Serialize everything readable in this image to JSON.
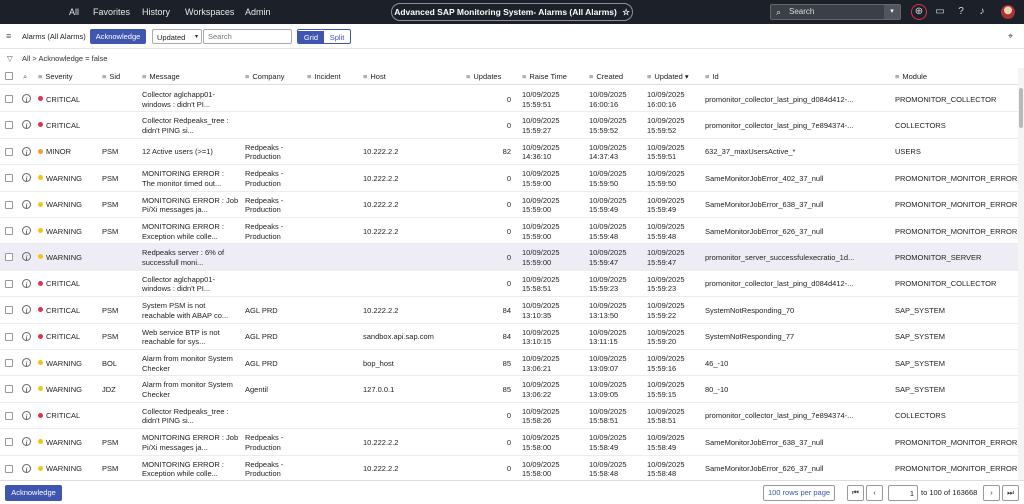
{
  "topnav": {
    "home": "All",
    "favorites": "Favorites",
    "history": "History",
    "workspaces": "Workspaces",
    "admin": "Admin",
    "title": "Advanced SAP Monitoring System- Alarms (All Alarms)",
    "search_placeholder": "Search"
  },
  "toolbar": {
    "list_title": "Alarms (All Alarms)",
    "acknowledge": "Acknowledge",
    "sort_field": "Updated",
    "search_placeholder": "Search",
    "grid": "Grid",
    "split": "Split"
  },
  "filter": {
    "breadcrumb": "All > Acknowledge = false"
  },
  "columns": [
    "Severity",
    "Sid",
    "Message",
    "Company",
    "Incident",
    "Host",
    "Updates",
    "Raise Time",
    "Created",
    "Updated",
    "Id",
    "Module"
  ],
  "rows": [
    {
      "severity": "CRITICAL",
      "color": "#e0334a",
      "sid": "",
      "msg1": "Collector aglchapp01-",
      "msg2": "windows : didn't PI...",
      "co1": "",
      "co2": "",
      "host": "",
      "updates": "0",
      "r1": "10/09/2025",
      "r2": "15:59:51",
      "c1": "10/09/2025",
      "c2": "16:00:16",
      "u1": "10/09/2025",
      "u2": "16:00:16",
      "id": "promonitor_collector_last_ping_d084d412-...",
      "module": "PROMONITOR_COLLECTOR"
    },
    {
      "severity": "CRITICAL",
      "color": "#e0334a",
      "sid": "",
      "msg1": "Collector Redpeaks_tree :",
      "msg2": "didn't PING si...",
      "co1": "",
      "co2": "",
      "host": "",
      "updates": "0",
      "r1": "10/09/2025",
      "r2": "15:59:27",
      "c1": "10/09/2025",
      "c2": "15:59:52",
      "u1": "10/09/2025",
      "u2": "15:59:52",
      "id": "promonitor_collector_last_ping_7e894374-...",
      "module": "COLLECTORS"
    },
    {
      "severity": "MINOR",
      "color": "#f29d38",
      "sid": "PSM",
      "msg1": "12 Active users (>=1)",
      "msg2": "",
      "co1": "Redpeaks -",
      "co2": "Production",
      "host": "10.222.2.2",
      "updates": "82",
      "r1": "10/09/2025",
      "r2": "14:36:10",
      "c1": "10/09/2025",
      "c2": "14:37:43",
      "u1": "10/09/2025",
      "u2": "15:59:51",
      "id": "632_37_maxUsersActive_*",
      "module": "USERS"
    },
    {
      "severity": "WARNING",
      "color": "#f2c318",
      "sid": "PSM",
      "msg1": "MONITORING ERROR :",
      "msg2": "The monitor timed out...",
      "co1": "Redpeaks -",
      "co2": "Production",
      "host": "10.222.2.2",
      "updates": "0",
      "r1": "10/09/2025",
      "r2": "15:59:00",
      "c1": "10/09/2025",
      "c2": "15:59:50",
      "u1": "10/09/2025",
      "u2": "15:59:50",
      "id": "SameMonitorJobError_402_37_null",
      "module": "PROMONITOR_MONITOR_ERROR"
    },
    {
      "severity": "WARNING",
      "color": "#f2c318",
      "sid": "PSM",
      "msg1": "MONITORING ERROR : Job",
      "msg2": "Pi/Xi messages ja...",
      "co1": "Redpeaks -",
      "co2": "Production",
      "host": "10.222.2.2",
      "updates": "0",
      "r1": "10/09/2025",
      "r2": "15:59:00",
      "c1": "10/09/2025",
      "c2": "15:59:49",
      "u1": "10/09/2025",
      "u2": "15:59:49",
      "id": "SameMonitorJobError_638_37_null",
      "module": "PROMONITOR_MONITOR_ERROR"
    },
    {
      "severity": "WARNING",
      "color": "#f2c318",
      "sid": "PSM",
      "msg1": "MONITORING ERROR :",
      "msg2": "Exception while colle...",
      "co1": "Redpeaks -",
      "co2": "Production",
      "host": "10.222.2.2",
      "updates": "0",
      "r1": "10/09/2025",
      "r2": "15:59:00",
      "c1": "10/09/2025",
      "c2": "15:59:48",
      "u1": "10/09/2025",
      "u2": "15:59:48",
      "id": "SameMonitorJobError_626_37_null",
      "module": "PROMONITOR_MONITOR_ERROR"
    },
    {
      "severity": "WARNING",
      "color": "#f2c318",
      "sid": "",
      "msg1": "Redpeaks server : 6% of",
      "msg2": "successfull moni...",
      "co1": "",
      "co2": "",
      "host": "",
      "updates": "0",
      "r1": "10/09/2025",
      "r2": "15:59:00",
      "c1": "10/09/2025",
      "c2": "15:59:47",
      "u1": "10/09/2025",
      "u2": "15:59:47",
      "id": "promonitor_server_successfulexecratio_1d...",
      "module": "PROMONITOR_SERVER",
      "selected": true
    },
    {
      "severity": "CRITICAL",
      "color": "#e0334a",
      "sid": "",
      "msg1": "Collector aglchapp01-",
      "msg2": "windows : didn't PI...",
      "co1": "",
      "co2": "",
      "host": "",
      "updates": "0",
      "r1": "10/09/2025",
      "r2": "15:58:51",
      "c1": "10/09/2025",
      "c2": "15:59:23",
      "u1": "10/09/2025",
      "u2": "15:59:23",
      "id": "promonitor_collector_last_ping_d084d412-...",
      "module": "PROMONITOR_COLLECTOR"
    },
    {
      "severity": "CRITICAL",
      "color": "#e0334a",
      "sid": "PSM",
      "msg1": "System PSM is not",
      "msg2": "reachable with ABAP co...",
      "co1": "AGL PRD",
      "co2": "",
      "host": "10.222.2.2",
      "updates": "84",
      "r1": "10/09/2025",
      "r2": "13:10:35",
      "c1": "10/09/2025",
      "c2": "13:13:50",
      "u1": "10/09/2025",
      "u2": "15:59:22",
      "id": "SystemNotResponding_70",
      "module": "SAP_SYSTEM"
    },
    {
      "severity": "CRITICAL",
      "color": "#e0334a",
      "sid": "PSM",
      "msg1": "Web service BTP is not",
      "msg2": "reachable for sys...",
      "co1": "AGL PRD",
      "co2": "",
      "host": "sandbox.api.sap.com",
      "updates": "84",
      "r1": "10/09/2025",
      "r2": "13:10:15",
      "c1": "10/09/2025",
      "c2": "13:11:15",
      "u1": "10/09/2025",
      "u2": "15:59:20",
      "id": "SystemNotResponding_77",
      "module": "SAP_SYSTEM"
    },
    {
      "severity": "WARNING",
      "color": "#f2c318",
      "sid": "BOL",
      "msg1": "Alarm from monitor System",
      "msg2": "Checker",
      "co1": "AGL PRD",
      "co2": "",
      "host": "bop_host",
      "updates": "85",
      "r1": "10/09/2025",
      "r2": "13:06:21",
      "c1": "10/09/2025",
      "c2": "13:09:07",
      "u1": "10/09/2025",
      "u2": "15:59:16",
      "id": "46_-10",
      "module": "SAP_SYSTEM"
    },
    {
      "severity": "WARNING",
      "color": "#f2c318",
      "sid": "JDZ",
      "msg1": "Alarm from monitor System",
      "msg2": "Checker",
      "co1": "Agentil",
      "co2": "",
      "host": "127.0.0.1",
      "updates": "85",
      "r1": "10/09/2025",
      "r2": "13:06:22",
      "c1": "10/09/2025",
      "c2": "13:09:05",
      "u1": "10/09/2025",
      "u2": "15:59:15",
      "id": "80_-10",
      "module": "SAP_SYSTEM"
    },
    {
      "severity": "CRITICAL",
      "color": "#e0334a",
      "sid": "",
      "msg1": "Collector Redpeaks_tree :",
      "msg2": "didn't PING si...",
      "co1": "",
      "co2": "",
      "host": "",
      "updates": "0",
      "r1": "10/09/2025",
      "r2": "15:58:26",
      "c1": "10/09/2025",
      "c2": "15:58:51",
      "u1": "10/09/2025",
      "u2": "15:58:51",
      "id": "promonitor_collector_last_ping_7e894374-...",
      "module": "COLLECTORS"
    },
    {
      "severity": "WARNING",
      "color": "#f2c318",
      "sid": "PSM",
      "msg1": "MONITORING ERROR : Job",
      "msg2": "Pi/Xi messages ja...",
      "co1": "Redpeaks -",
      "co2": "Production",
      "host": "10.222.2.2",
      "updates": "0",
      "r1": "10/09/2025",
      "r2": "15:58:00",
      "c1": "10/09/2025",
      "c2": "15:58:49",
      "u1": "10/09/2025",
      "u2": "15:58:49",
      "id": "SameMonitorJobError_638_37_null",
      "module": "PROMONITOR_MONITOR_ERROR"
    },
    {
      "severity": "WARNING",
      "color": "#f2c318",
      "sid": "PSM",
      "msg1": "MONITORING ERROR :",
      "msg2": "Exception while colle...",
      "co1": "Redpeaks -",
      "co2": "Production",
      "host": "10.222.2.2",
      "updates": "0",
      "r1": "10/09/2025",
      "r2": "15:58:00",
      "c1": "10/09/2025",
      "c2": "15:58:48",
      "u1": "10/09/2025",
      "u2": "15:58:48",
      "id": "SameMonitorJobError_626_37_null",
      "module": "PROMONITOR_MONITOR_ERROR"
    }
  ],
  "footer": {
    "acknowledge": "Acknowledge",
    "rows_per_page": "100 rows per page",
    "page_value": "1",
    "range_text": "to 100 of 163668"
  }
}
